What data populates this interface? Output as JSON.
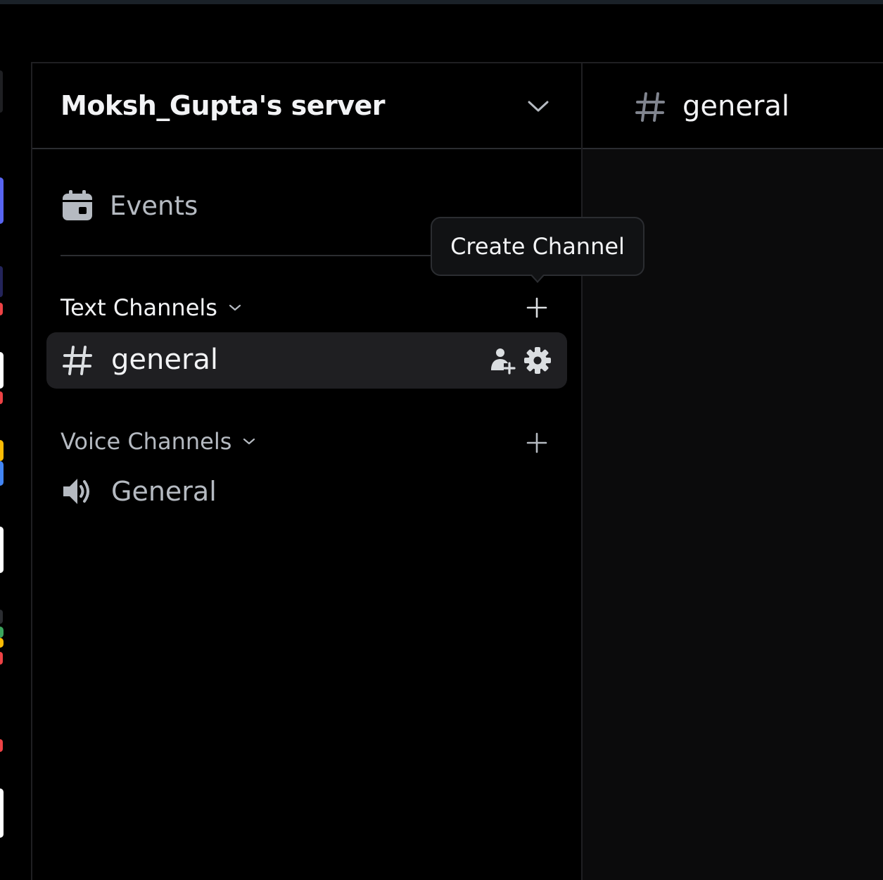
{
  "server": {
    "name": "Moksh_Gupta's server"
  },
  "nav": {
    "events_label": "Events"
  },
  "categories": {
    "text": {
      "label": "Text Channels"
    },
    "voice": {
      "label": "Voice Channels"
    }
  },
  "channels": {
    "text": [
      {
        "label": "general"
      }
    ],
    "voice": [
      {
        "label": "General"
      }
    ]
  },
  "tooltip": {
    "text": "Create Channel"
  },
  "main": {
    "channel_title": "general"
  },
  "colors": {
    "background": "#000000",
    "active_channel_bg": "#1f1f22",
    "muted_text": "#b5bac1",
    "primary_text": "#f2f3f5"
  },
  "icons": {
    "server_menu": "chevron-down-icon",
    "events": "calendar-icon",
    "text_channel": "hash-icon",
    "voice_channel": "speaker-icon",
    "invite": "add-member-icon",
    "settings": "gear-icon",
    "create_channel": "plus-icon"
  }
}
